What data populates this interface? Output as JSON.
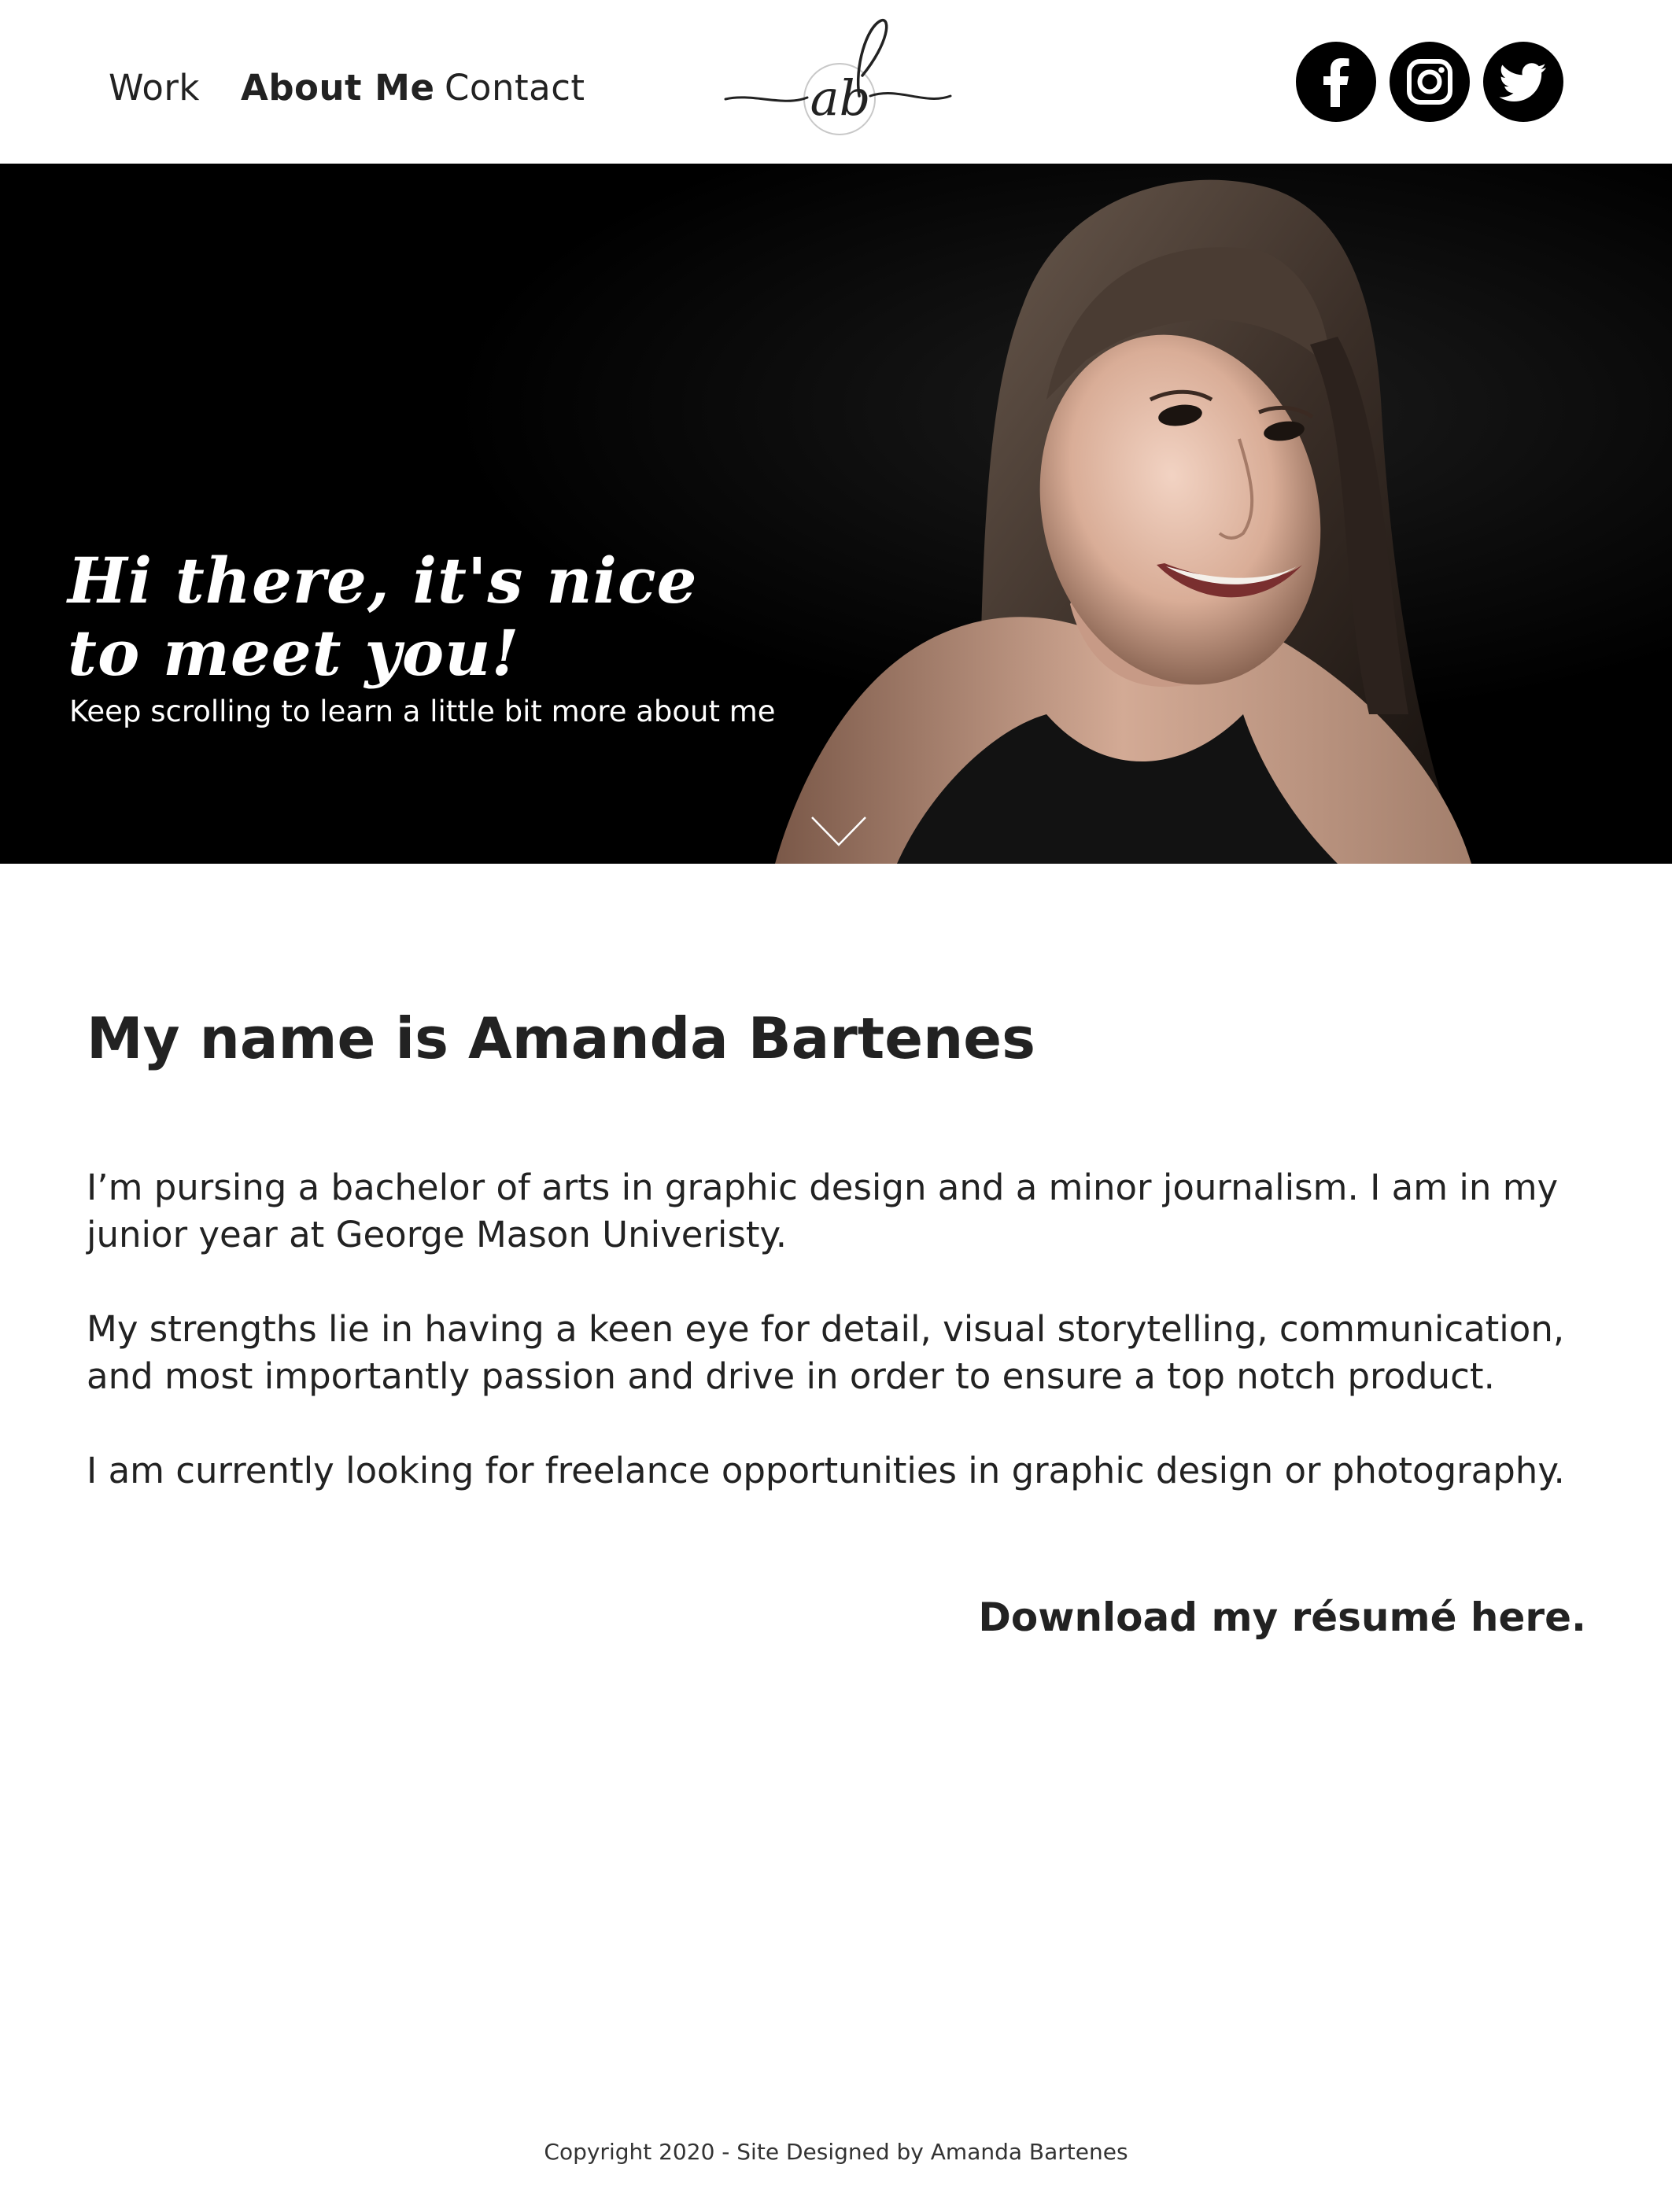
{
  "header": {
    "nav": [
      {
        "label": "Work",
        "active": false
      },
      {
        "label": "About Me",
        "active": true
      },
      {
        "label": "Contact",
        "active": false
      }
    ],
    "logo_text": "ab",
    "social": [
      "facebook-icon",
      "instagram-icon",
      "twitter-icon"
    ]
  },
  "hero": {
    "title_line1": "Hi there, it's nice",
    "title_line2": "to meet you!",
    "subtitle": "Keep scrolling to learn a little bit more about me",
    "scroll_icon": "chevron-down-icon"
  },
  "main": {
    "heading": "My name is Amanda Bartenes",
    "paragraphs": [
      "I’m pursing a bachelor of arts in graphic design and a minor journalism. I am in my junior year at George Mason Univeristy.",
      "My strengths lie in having a keen eye for detail, visual storytelling, communication, and most importantly passion and drive in order to ensure a top notch product.",
      "I am currently looking for freelance opportunities in graphic design or photography."
    ],
    "resume_link": "Download my résumé here."
  },
  "footer": {
    "copyright": "Copyright 2020 - Site Designed by Amanda Bartenes"
  },
  "colors": {
    "text": "#222222",
    "hero_background": "#000000",
    "hero_text": "#ffffff",
    "icon_fill": "#000000"
  }
}
